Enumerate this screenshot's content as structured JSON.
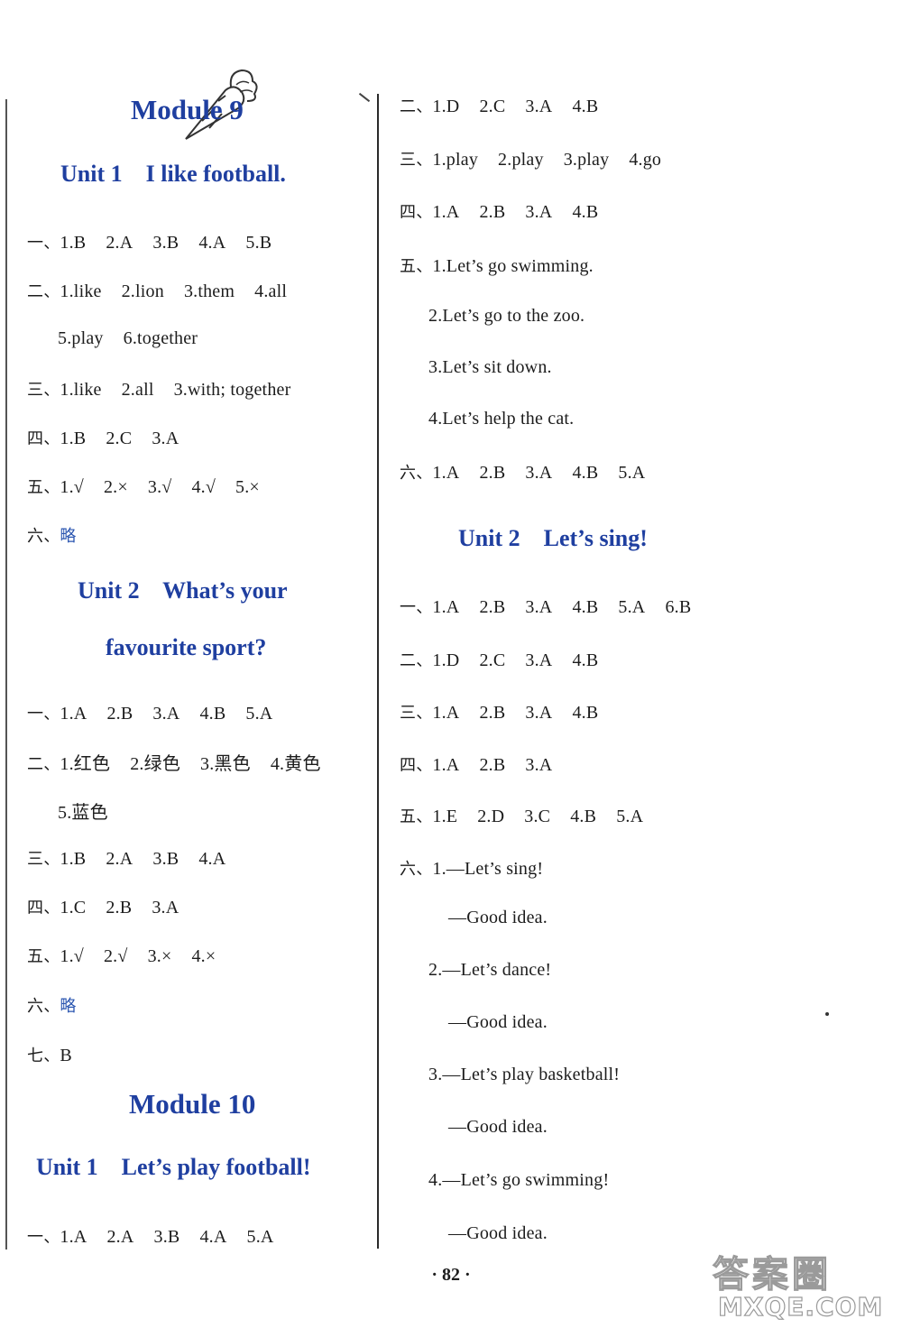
{
  "page_number": "· 82 ·",
  "left_column": {
    "module9": {
      "title": "Module 9",
      "unit1": {
        "title": "Unit 1    I like football.",
        "lines": [
          {
            "label": "一、",
            "items": [
              "1.B",
              "2.A",
              "3.B",
              "4.A",
              "5.B"
            ]
          },
          {
            "label": "二、",
            "items": [
              "1.like",
              "2.lion",
              "3.them",
              "4.all"
            ]
          },
          {
            "label": "",
            "items": [
              "5.play",
              "6.together"
            ]
          },
          {
            "label": "三、",
            "items": [
              "1.like",
              "2.all",
              "3.with; together"
            ]
          },
          {
            "label": "四、",
            "items": [
              "1.B",
              "2.C",
              "3.A"
            ]
          },
          {
            "label": "五、",
            "items": [
              "1.√",
              "2.×",
              "3.√",
              "4.√",
              "5.×"
            ]
          },
          {
            "label": "六、",
            "items": [
              "略"
            ]
          }
        ]
      },
      "unit2": {
        "title_line1": "Unit 2    What’s your",
        "title_line2": "favourite sport?",
        "lines": [
          {
            "label": "一、",
            "items": [
              "1.A",
              "2.B",
              "3.A",
              "4.B",
              "5.A"
            ]
          },
          {
            "label": "二、",
            "items": [
              "1.红色",
              "2.绿色",
              "3.黑色",
              "4.黄色"
            ]
          },
          {
            "label": "",
            "items": [
              "5.蓝色"
            ]
          },
          {
            "label": "三、",
            "items": [
              "1.B",
              "2.A",
              "3.B",
              "4.A"
            ]
          },
          {
            "label": "四、",
            "items": [
              "1.C",
              "2.B",
              "3.A"
            ]
          },
          {
            "label": "五、",
            "items": [
              "1.√",
              "2.√",
              "3.×",
              "4.×"
            ]
          },
          {
            "label": "六、",
            "items": [
              "略"
            ]
          },
          {
            "label": "七、",
            "items": [
              "B"
            ]
          }
        ]
      }
    },
    "module10": {
      "title": "Module 10",
      "unit1": {
        "title": "Unit 1    Let’s play football!",
        "lines": [
          {
            "label": "一、",
            "items": [
              "1.A",
              "2.A",
              "3.B",
              "4.A",
              "5.A"
            ]
          }
        ]
      }
    }
  },
  "right_column": {
    "module10_unit1_cont": {
      "lines": [
        {
          "label": "二、",
          "items": [
            "1.D",
            "2.C",
            "3.A",
            "4.B"
          ]
        },
        {
          "label": "三、",
          "items": [
            "1.play",
            "2.play",
            "3.play",
            "4.go"
          ]
        },
        {
          "label": "四、",
          "items": [
            "1.A",
            "2.B",
            "3.A",
            "4.B"
          ]
        },
        {
          "label": "五、",
          "items": [
            "1.Let’s go swimming."
          ]
        },
        {
          "label": "",
          "items": [
            "2.Let’s go to the zoo."
          ]
        },
        {
          "label": "",
          "items": [
            "3.Let’s sit down."
          ]
        },
        {
          "label": "",
          "items": [
            "4.Let’s help the cat."
          ]
        },
        {
          "label": "六、",
          "items": [
            "1.A",
            "2.B",
            "3.A",
            "4.B",
            "5.A"
          ]
        }
      ]
    },
    "module10_unit2": {
      "title": "Unit 2    Let’s sing!",
      "lines": [
        {
          "label": "一、",
          "items": [
            "1.A",
            "2.B",
            "3.A",
            "4.B",
            "5.A",
            "6.B"
          ]
        },
        {
          "label": "二、",
          "items": [
            "1.D",
            "2.C",
            "3.A",
            "4.B"
          ]
        },
        {
          "label": "三、",
          "items": [
            "1.A",
            "2.B",
            "3.A",
            "4.B"
          ]
        },
        {
          "label": "四、",
          "items": [
            "1.A",
            "2.B",
            "3.A"
          ]
        },
        {
          "label": "五、",
          "items": [
            "1.E",
            "2.D",
            "3.C",
            "4.B",
            "5.A"
          ]
        },
        {
          "label": "六、",
          "items": [
            "1.—Let’s sing!"
          ]
        },
        {
          "label": "",
          "items": [
            "—Good idea."
          ]
        },
        {
          "label": "",
          "items": [
            "2.—Let’s dance!"
          ]
        },
        {
          "label": "",
          "items": [
            "—Good idea."
          ]
        },
        {
          "label": "",
          "items": [
            "3.—Let’s play basketball!"
          ]
        },
        {
          "label": "",
          "items": [
            "—Good idea."
          ]
        },
        {
          "label": "",
          "items": [
            "4.—Let’s go swimming!"
          ]
        },
        {
          "label": "",
          "items": [
            "—Good idea."
          ]
        }
      ]
    }
  },
  "watermark": {
    "top": "答案圈",
    "bottom": "MXQE.COM"
  },
  "colors": {
    "heading": "#1f3fa0",
    "text": "#1c1c1c"
  }
}
